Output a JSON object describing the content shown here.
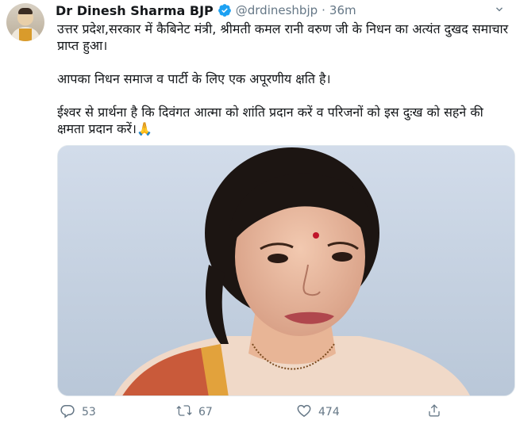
{
  "tweet": {
    "author_name": "Dr Dinesh Sharma BJP",
    "handle": "@drdineshbjp",
    "separator": "·",
    "time": "36m",
    "paragraphs": [
      "उत्तर प्रदेश,सरकार में कैबिनेट मंत्री, श्रीमती कमल रानी वरुण जी के निधन का अत्यंत दुखद समाचार प्राप्त हुआ।",
      "आपका निधन समाज व पार्टी के लिए एक अपूरणीय क्षति है।",
      "ईश्वर से प्रार्थना है कि दिवंगत आत्मा को शांति प्रदान करें व परिजनों को इस दुःख को सहने की क्षमता प्रदान करें।🙏"
    ],
    "reply_count": "53",
    "retweet_count": "67",
    "like_count": "474"
  },
  "icons": {
    "verified": "verified-badge-icon",
    "reply": "reply-icon",
    "retweet": "retweet-icon",
    "like": "heart-icon",
    "share": "share-icon",
    "more": "chevron-down-icon"
  },
  "colors": {
    "verified_blue": "#1da1f2",
    "text_primary": "#14171a",
    "text_secondary": "#657786",
    "photo_background": "#c7d3e2"
  }
}
